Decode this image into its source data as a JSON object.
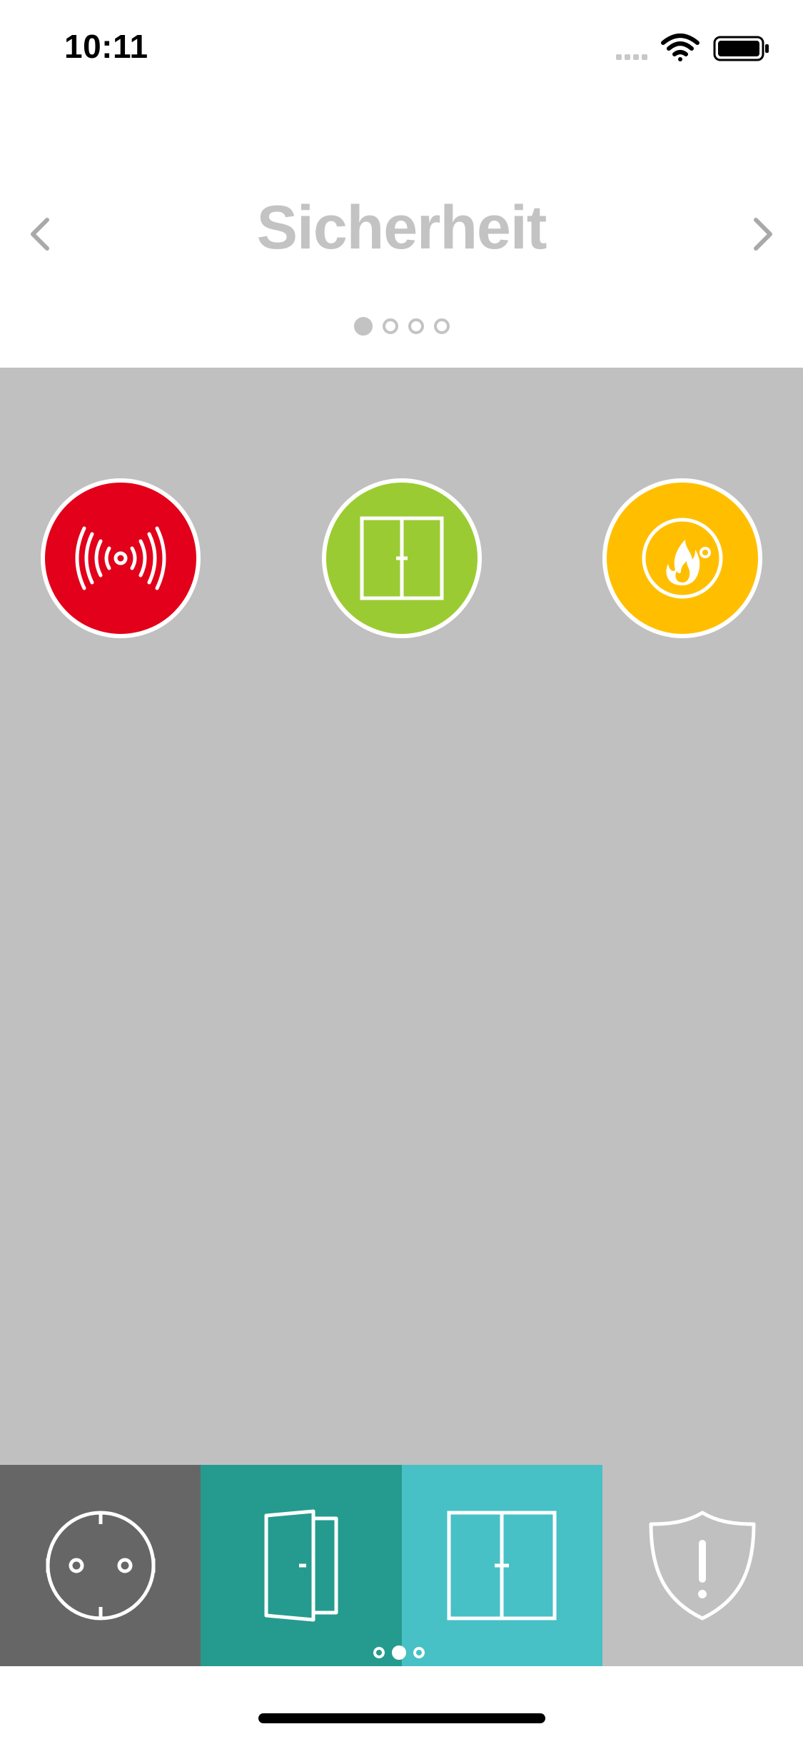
{
  "status_bar": {
    "time": "10:11",
    "icons": [
      "signal-icon",
      "wifi-icon",
      "battery-icon"
    ]
  },
  "header": {
    "title": "Sicherheit",
    "prev_icon": "chevron-left-icon",
    "next_icon": "chevron-right-icon",
    "page_count": 4,
    "active_page": 1
  },
  "devices": [
    {
      "name": "alarm",
      "icon": "alarm-signal-icon",
      "color": "#e2001a"
    },
    {
      "name": "window",
      "icon": "window-icon",
      "color": "#9bcb33"
    },
    {
      "name": "smoke-detector",
      "icon": "smoke-detector-icon",
      "color": "#ffbf00"
    }
  ],
  "bottom_tabs": [
    {
      "name": "outlet",
      "icon": "power-outlet-icon",
      "color": "#666666"
    },
    {
      "name": "door",
      "icon": "door-icon",
      "color": "#259b8f"
    },
    {
      "name": "window",
      "icon": "window-icon",
      "color": "#47c1c6"
    },
    {
      "name": "security",
      "icon": "shield-alert-icon",
      "color": "#c0c0c0"
    }
  ],
  "bottom_pager": {
    "count": 3,
    "active": 2
  },
  "colors": {
    "content_bg": "#c0c0c0",
    "title": "#c3c3c3"
  }
}
